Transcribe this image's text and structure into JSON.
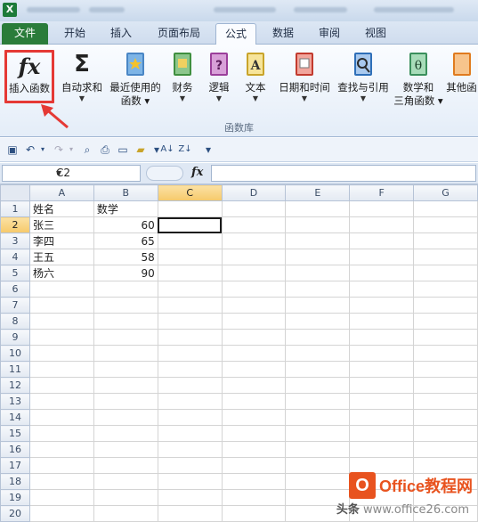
{
  "titlebar": {
    "app_icon": "X"
  },
  "tabs": [
    {
      "name": "file",
      "label": "文件"
    },
    {
      "name": "home",
      "label": "开始"
    },
    {
      "name": "insert",
      "label": "插入"
    },
    {
      "name": "layout",
      "label": "页面布局"
    },
    {
      "name": "formulas",
      "label": "公式"
    },
    {
      "name": "data",
      "label": "数据"
    },
    {
      "name": "review",
      "label": "审阅"
    },
    {
      "name": "view",
      "label": "视图"
    }
  ],
  "ribbon": {
    "group_label": "函数库",
    "buttons": [
      {
        "label": "插入函数",
        "icon": "fx-icon"
      },
      {
        "label": "自动求和",
        "icon": "sigma-icon"
      },
      {
        "label": "最近使用的",
        "label2": "函数",
        "icon": "book-star-icon"
      },
      {
        "label": "财务",
        "icon": "book-finance-icon"
      },
      {
        "label": "逻辑",
        "icon": "book-question-icon"
      },
      {
        "label": "文本",
        "icon": "book-text-icon"
      },
      {
        "label": "日期和时间",
        "icon": "book-calendar-icon"
      },
      {
        "label": "查找与引用",
        "icon": "book-search-icon"
      },
      {
        "label": "数学和",
        "label2": "三角函数",
        "icon": "book-theta-icon"
      },
      {
        "label": "其他函",
        "icon": "book-more-icon"
      }
    ],
    "fx_glyph": "fx",
    "sigma_glyph": "Σ",
    "text_glyph": "A",
    "theta_glyph": "θ",
    "question_glyph": "?"
  },
  "formula_bar": {
    "name_box": "C2",
    "fx_label": "fx",
    "value": ""
  },
  "columns": [
    "A",
    "B",
    "C",
    "D",
    "E",
    "F",
    "G"
  ],
  "selected_column": "C",
  "selected_row": 2,
  "rows": [
    {
      "n": "1",
      "a": "姓名",
      "b": "数学"
    },
    {
      "n": "2",
      "a": "张三",
      "b": "60"
    },
    {
      "n": "3",
      "a": "李四",
      "b": "65"
    },
    {
      "n": "4",
      "a": "王五",
      "b": "58"
    },
    {
      "n": "5",
      "a": "杨六",
      "b": "90"
    },
    {
      "n": "6",
      "a": "",
      "b": ""
    },
    {
      "n": "7",
      "a": "",
      "b": ""
    },
    {
      "n": "8",
      "a": "",
      "b": ""
    },
    {
      "n": "9",
      "a": "",
      "b": ""
    },
    {
      "n": "10",
      "a": "",
      "b": ""
    },
    {
      "n": "11",
      "a": "",
      "b": ""
    },
    {
      "n": "12",
      "a": "",
      "b": ""
    },
    {
      "n": "13",
      "a": "",
      "b": ""
    },
    {
      "n": "14",
      "a": "",
      "b": ""
    },
    {
      "n": "15",
      "a": "",
      "b": ""
    },
    {
      "n": "16",
      "a": "",
      "b": ""
    },
    {
      "n": "17",
      "a": "",
      "b": ""
    },
    {
      "n": "18",
      "a": "",
      "b": ""
    },
    {
      "n": "19",
      "a": "",
      "b": ""
    },
    {
      "n": "20",
      "a": "",
      "b": ""
    }
  ],
  "watermark": {
    "logo": "O",
    "brand": "Office教程网",
    "url_prefix": "头条",
    "url": "www.office26.com"
  },
  "colors": {
    "file_tab": "#2a7c3a",
    "highlight_box": "#e53935",
    "brand": "#e8531f"
  }
}
